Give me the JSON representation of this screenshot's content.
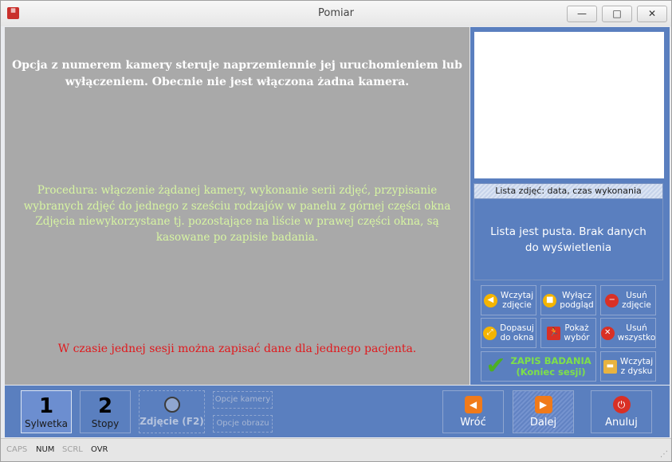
{
  "window": {
    "title": "Pomiar",
    "icon": "app-grid-icon",
    "min": "—",
    "max": "□",
    "close": "✕"
  },
  "messages": {
    "camera_info": "Opcja z numerem kamery steruje naprzemiennie jej uruchomieniem lub wyłączeniem. Obecnie nie jest włączona żadna kamera.",
    "procedure": "Procedura: włączenie żądanej kamery, wykonanie serii zdjęć, przypisanie wybranych zdjęć do jednego z sześciu rodzajów w panelu z górnej części okna Zdjęcia niewykorzystane tj. pozostające na liście w prawej części okna, są kasowane po zapisie badania.",
    "session_warning": "W czasie jednej sesji można zapisać dane dla jednego pacjenta."
  },
  "photo_list": {
    "header": "Lista zdjęć: data, czas wykonania",
    "empty": "Lista jest pusta. Brak danych do wyświetlenia"
  },
  "actions": {
    "load_photo": "Wczytaj\nzdjęcie",
    "disable_preview": "Wyłącz\npodgląd",
    "delete_photo": "Usuń\nzdjęcie",
    "fit_window": "Dopasuj\ndo okna",
    "show_selection": "Pokaż\nwybór",
    "delete_all": "Usuń\nwszystko",
    "save_exam_line1": "ZAPIS BADANIA",
    "save_exam_line2": "(Koniec sesji)",
    "load_disk": "Wczytaj\nz dysku"
  },
  "toolbar": {
    "camera1_num": "1",
    "camera1_label": "Sylwetka",
    "camera2_num": "2",
    "camera2_label": "Stopy",
    "photo_label": "Zdjęcie (F2)",
    "camera_options": "Opcje kamery",
    "image_options": "Opcje obrazu",
    "back": "Wróć",
    "next": "Dalej",
    "cancel": "Anuluj"
  },
  "status": {
    "caps": "CAPS",
    "num": "NUM",
    "scrl": "SCRL",
    "ovr": "OVR"
  },
  "colors": {
    "panel": "#5a7fbf",
    "canvas": "#a9a9a9",
    "warning": "#e0191d",
    "procedure": "#d7f5a2",
    "save_green": "#4caf23"
  }
}
